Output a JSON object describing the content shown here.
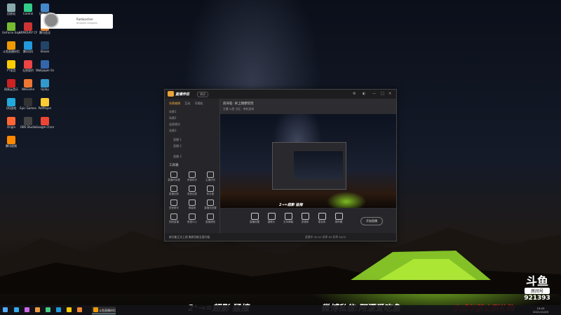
{
  "desktop_icons": [
    {
      "label": "回收站",
      "color": "#8aa"
    },
    {
      "label": "Control",
      "color": "#3c8"
    },
    {
      "label": "控制面板",
      "color": "#48c"
    },
    {
      "label": "GeForce Experience",
      "color": "#7b3"
    },
    {
      "label": "ARMOURY CRATE",
      "color": "#c33"
    },
    {
      "label": "腾讯会议",
      "color": "#e83"
    },
    {
      "label": "斗鱼直播伴侣",
      "color": "#e90"
    },
    {
      "label": "腾讯QQ",
      "color": "#29d"
    },
    {
      "label": "Steam",
      "color": "#246"
    },
    {
      "label": "YY语音",
      "color": "#fc0"
    },
    {
      "label": "无畏契约",
      "color": "#e44"
    },
    {
      "label": "Wallpaper Engine",
      "color": "#36a"
    },
    {
      "label": "网易云音乐",
      "color": "#c22"
    },
    {
      "label": "WeGame",
      "color": "#e73"
    },
    {
      "label": "Uplay",
      "color": "#39c"
    },
    {
      "label": "QQ游戏",
      "color": "#2ad"
    },
    {
      "label": "Epic Games",
      "color": "#333"
    },
    {
      "label": "PotPlayer",
      "color": "#fc3"
    },
    {
      "label": "Origin",
      "color": "#f63"
    },
    {
      "label": "OBS Studio",
      "color": "#444"
    },
    {
      "label": "Google Chrome",
      "color": "#e43"
    },
    {
      "label": "腾讯视频",
      "color": "#f80"
    }
  ],
  "notification": {
    "title": "Radioactive",
    "subtitle": "Imagine Dragons"
  },
  "app": {
    "name": "直播伴侣",
    "version": "测试",
    "left_tabs": [
      "场景编辑",
      "互动",
      "可视化"
    ],
    "scenes": [
      "场景1",
      "场景2",
      "竖屏模式",
      "场景3"
    ],
    "sources": [
      "直播 1",
      "直播 2",
      "直播 3"
    ],
    "tools_title": "工具箱",
    "tools": [
      "直播间设置",
      "房管助手",
      "主播任务",
      "直播回放",
      "语音连麦",
      "粉丝团",
      "语音聊天",
      "弹幕姬",
      "直播流设置",
      "视频直播",
      "数据中心",
      "直播课堂"
    ],
    "status": "新功能正式上线 美颜功能全面升级",
    "status_right": "直播中 00:00 帧率 60 码率 6000",
    "room_title": "房间名: 早上随便玩玩",
    "room_sub": "主播 斗鱼 分区 · 单机游戏",
    "controls": [
      "直播设置",
      "摄像头",
      "文本弹幕",
      "多媒体",
      "麦克风",
      "扬声器"
    ],
    "live_button": "开始直播",
    "preview_caption": "2→=超影 猛猪"
  },
  "overlay": {
    "left": "2⁺→=超影  猛撞",
    "mid": "微博私信:阿漂爱吃鱼",
    "right": "未成年禁止刷礼物",
    "brand": "斗鱼",
    "room_label": "房间号",
    "room_number": "921393"
  },
  "taskbar": {
    "app_label": "斗鱼直播伴侣",
    "time": "19:03",
    "date": "2021/11/29",
    "pinned_colors": [
      "#3ae",
      "#c6e",
      "#e94",
      "#4c8",
      "#29d",
      "#fc0",
      "#e83"
    ]
  }
}
